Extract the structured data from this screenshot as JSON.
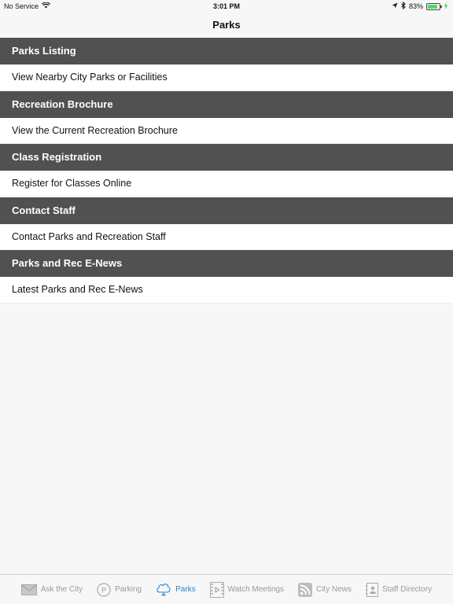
{
  "status_bar": {
    "carrier": "No Service",
    "time": "3:01 PM",
    "battery_percent": "83%",
    "battery_level": 0.83
  },
  "nav": {
    "title": "Parks"
  },
  "sections": [
    {
      "header": "Parks Listing",
      "row": "View Nearby City Parks or Facilities"
    },
    {
      "header": "Recreation Brochure",
      "row": "View the Current Recreation Brochure"
    },
    {
      "header": "Class Registration",
      "row": "Register for Classes Online"
    },
    {
      "header": "Contact Staff",
      "row": "Contact Parks and Recreation Staff"
    },
    {
      "header": "Parks and Rec E-News",
      "row": "Latest Parks and Rec E-News"
    }
  ],
  "tabs": [
    {
      "label": "Ask the City",
      "icon": "envelope-icon",
      "active": false
    },
    {
      "label": "Parking",
      "icon": "parking-icon",
      "active": false
    },
    {
      "label": "Parks",
      "icon": "tree-icon",
      "active": true
    },
    {
      "label": "Watch Meetings",
      "icon": "video-icon",
      "active": false
    },
    {
      "label": "City News",
      "icon": "rss-icon",
      "active": false
    },
    {
      "label": "Staff Directory",
      "icon": "contact-card-icon",
      "active": false
    }
  ],
  "colors": {
    "section_header_bg": "#515151",
    "active_tab": "#2a86d4",
    "inactive_tab": "#999999",
    "battery": "#4cd964"
  }
}
